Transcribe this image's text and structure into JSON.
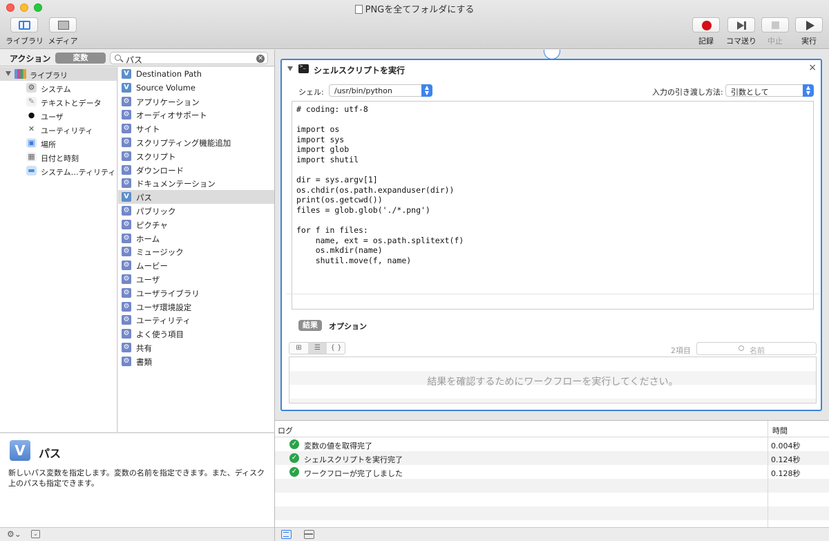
{
  "window": {
    "title": "PNGを全てフォルダにする"
  },
  "toolbar": {
    "library_label": "ライブラリ",
    "media_label": "メディア",
    "record_label": "記録",
    "step_label": "コマ送り",
    "stop_label": "中止",
    "run_label": "実行"
  },
  "library": {
    "actions_tab": "アクション",
    "variables_tab": "変数",
    "search_value": "パス",
    "root_label": "ライブラリ",
    "categories": [
      {
        "label": "システム",
        "icon": "system-icon"
      },
      {
        "label": "テキストとデータ",
        "icon": "text-data-icon"
      },
      {
        "label": "ユーザ",
        "icon": "user-icon"
      },
      {
        "label": "ユーティリティ",
        "icon": "utilities-icon"
      },
      {
        "label": "場所",
        "icon": "location-icon"
      },
      {
        "label": "日付と時刻",
        "icon": "date-time-icon"
      },
      {
        "label": "システム…ティリティ",
        "icon": "system-utilities-icon"
      }
    ],
    "actions": [
      {
        "label": "Destination Path",
        "icon": "V"
      },
      {
        "label": "Source Volume",
        "icon": "V"
      },
      {
        "label": "アプリケーション",
        "icon": "gear"
      },
      {
        "label": "オーディオサポート",
        "icon": "gear"
      },
      {
        "label": "サイト",
        "icon": "gear"
      },
      {
        "label": "スクリプティング機能追加",
        "icon": "gear"
      },
      {
        "label": "スクリプト",
        "icon": "gear"
      },
      {
        "label": "ダウンロード",
        "icon": "gear"
      },
      {
        "label": "ドキュメンテーション",
        "icon": "gear"
      },
      {
        "label": "パス",
        "icon": "V"
      },
      {
        "label": "パブリック",
        "icon": "gear"
      },
      {
        "label": "ピクチャ",
        "icon": "gear"
      },
      {
        "label": "ホーム",
        "icon": "gear"
      },
      {
        "label": "ミュージック",
        "icon": "gear"
      },
      {
        "label": "ムービー",
        "icon": "gear"
      },
      {
        "label": "ユーザ",
        "icon": "gear"
      },
      {
        "label": "ユーザライブラリ",
        "icon": "gear"
      },
      {
        "label": "ユーザ環境設定",
        "icon": "gear"
      },
      {
        "label": "ユーティリティ",
        "icon": "gear"
      },
      {
        "label": "よく使う項目",
        "icon": "gear"
      },
      {
        "label": "共有",
        "icon": "gear"
      },
      {
        "label": "書類",
        "icon": "gear"
      }
    ],
    "selected_action": "パス"
  },
  "description": {
    "icon_letter": "V",
    "title": "パス",
    "text": "新しいパス変数を指定します。変数の名前を指定できます。また、ディスク上のパスも指定できます。"
  },
  "action_card": {
    "title": "シェルスクリプトを実行",
    "shell_label": "シェル:",
    "shell_value": "/usr/bin/python",
    "input_label": "入力の引き渡し方法:",
    "input_value": "引数として",
    "code": "# coding: utf-8\n\nimport os\nimport sys\nimport glob\nimport shutil\n\ndir = sys.argv[1]\nos.chdir(os.path.expanduser(dir))\nprint(os.getcwd())\nfiles = glob.glob('./*.png')\n\nfor f in files:\n    name, ext = os.path.splitext(f)\n    os.mkdir(name)\n    shutil.move(f, name)",
    "results_tab": "結果",
    "options_tab": "オプション",
    "view_modes": [
      "⊞",
      "☰",
      "{ }"
    ],
    "item_count": "2項目",
    "filter_placeholder": "名前",
    "results_message": "結果を確認するためにワークフローを実行してください。"
  },
  "log": {
    "col_log": "ログ",
    "col_time": "時間",
    "rows": [
      {
        "message": "変数の値を取得完了",
        "time": "0.004秒"
      },
      {
        "message": "シェルスクリプトを実行完了",
        "time": "0.124秒"
      },
      {
        "message": "ワークフローが完了しました",
        "time": "0.128秒"
      }
    ]
  },
  "colors": {
    "accent": "#3c86d6",
    "record": "#d40f17",
    "success": "#2aa34a"
  }
}
